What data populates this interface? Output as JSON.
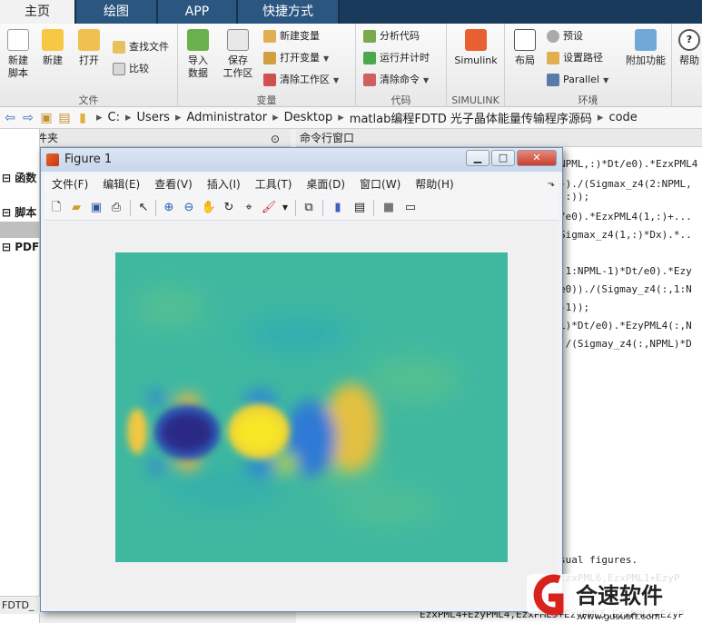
{
  "tabs": [
    "主页",
    "绘图",
    "APP",
    "快捷方式"
  ],
  "ribbon": {
    "file": {
      "label": "文件",
      "new_script": "新建\n脚本",
      "new": "新建",
      "open": "打开",
      "find_files": "查找文件",
      "compare": "比较"
    },
    "variable": {
      "label": "变量",
      "import": "导入\n数据",
      "save_ws": "保存\n工作区",
      "new_var": "新建变量",
      "open_var": "打开变量",
      "clear_ws": "清除工作区"
    },
    "code": {
      "label": "代码",
      "analyze": "分析代码",
      "run_time": "运行并计时",
      "clear_cmd": "清除命令"
    },
    "simulink": {
      "label": "SIMULINK",
      "btn": "Simulink"
    },
    "env": {
      "label": "环境",
      "layout": "布局",
      "prefs": "预设",
      "set_path": "设置路径",
      "parallel": "Parallel",
      "addons": "附加功能"
    },
    "help": {
      "btn": "帮助"
    }
  },
  "address": {
    "crumbs": [
      "C:",
      "Users",
      "Administrator",
      "Desktop",
      "matlab编程FDTD 光子晶体能量传输程序源码",
      "code"
    ]
  },
  "panels": {
    "current_folder": "当前文件夹",
    "cmd_window": "命令行窗口",
    "left_items": [
      "函数",
      "脚本",
      "PDF"
    ],
    "status": "FDTD_"
  },
  "command_lines": [
    "NPML,:)*Dt/e0).*EzxPML4",
    "))./(Sigmax_z4(2:NPML,",
    ",:));",
    "/e0).*EzxPML4(1,:)+...",
    "Sigmax_z4(1,:)*Dx).*..",
    ",1:NPML-1)*Dt/e0).*Ezy",
    "e0))./(Sigmay_z4(:,1:N",
    "-1));",
    "L)*Dt/e0).*EzyPML4(:,N",
    "./(Sigmay_z4(:,NPML)*D",
    "sual figures.",
    "EzxPML6,EzxPML1+EzyP",
    "EzxPML4+EzyPML4,EzxPML5+EzyPML5,EzxPML6+EzyP"
  ],
  "figure": {
    "title": "Figure 1",
    "menu": [
      "文件(F)",
      "编辑(E)",
      "查看(V)",
      "插入(I)",
      "工具(T)",
      "桌面(D)",
      "窗口(W)",
      "帮助(H)"
    ]
  },
  "watermark": {
    "brand": "合速软件",
    "url": "www.gusuoft.com"
  },
  "colors": {
    "tabbar": "#1a3a5c",
    "field_bg": "#3fb8a0",
    "blob_dark": "#2a2a86",
    "blob_yellow": "#f5e626"
  }
}
